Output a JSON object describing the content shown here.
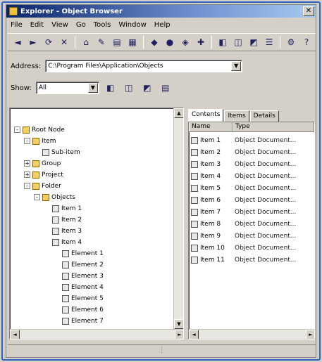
{
  "window": {
    "title": "Explorer - Object Browser"
  },
  "menu": [
    "File",
    "Edit",
    "View",
    "Go",
    "Tools",
    "Window",
    "Help"
  ],
  "toolbar": [
    "◄",
    "►",
    "⟳",
    "✕",
    "⌂",
    "✎",
    "▤",
    "▦",
    "◆",
    "●",
    "◈",
    "✚",
    "◧",
    "◫",
    "◩",
    "☰",
    "⚙",
    "?"
  ],
  "address": {
    "label": "Address:",
    "value": "C:\\Program Files\\Application\\Objects"
  },
  "filter": {
    "label": "Show:",
    "value": "All"
  },
  "tree": [
    {
      "indent": 0,
      "exp": "-",
      "label": "Root Node",
      "icon": "folder"
    },
    {
      "indent": 1,
      "exp": "-",
      "label": "Item",
      "icon": "folder"
    },
    {
      "indent": 2,
      "exp": "",
      "label": "Sub-item",
      "icon": "doc"
    },
    {
      "indent": 1,
      "exp": "+",
      "label": "Group",
      "icon": "folder"
    },
    {
      "indent": 1,
      "exp": "+",
      "label": "Project",
      "icon": "folder"
    },
    {
      "indent": 1,
      "exp": "-",
      "label": "Folder",
      "icon": "folder"
    },
    {
      "indent": 2,
      "exp": "-",
      "label": "Objects",
      "icon": "folder"
    },
    {
      "indent": 3,
      "exp": "",
      "label": "Item 1",
      "icon": "doc"
    },
    {
      "indent": 3,
      "exp": "",
      "label": "Item 2",
      "icon": "doc"
    },
    {
      "indent": 3,
      "exp": "",
      "label": "Item 3",
      "icon": "doc"
    },
    {
      "indent": 3,
      "exp": "",
      "label": "Item 4",
      "icon": "doc"
    },
    {
      "indent": 4,
      "exp": "",
      "label": "Element 1",
      "icon": "doc"
    },
    {
      "indent": 4,
      "exp": "",
      "label": "Element 2",
      "icon": "doc"
    },
    {
      "indent": 4,
      "exp": "",
      "label": "Element 3",
      "icon": "doc"
    },
    {
      "indent": 4,
      "exp": "",
      "label": "Element 4",
      "icon": "doc"
    },
    {
      "indent": 4,
      "exp": "",
      "label": "Element 5",
      "icon": "doc"
    },
    {
      "indent": 4,
      "exp": "",
      "label": "Element 6",
      "icon": "doc"
    },
    {
      "indent": 4,
      "exp": "",
      "label": "Element 7",
      "icon": "doc"
    }
  ],
  "tabs": [
    "Contents",
    "Items",
    "Details"
  ],
  "columns": [
    "Name",
    "Type"
  ],
  "rows": [
    {
      "name": "Item 1",
      "type": "Object Document..."
    },
    {
      "name": "Item 2",
      "type": "Object Document..."
    },
    {
      "name": "Item 3",
      "type": "Object Document..."
    },
    {
      "name": "Item 4",
      "type": "Object Document..."
    },
    {
      "name": "Item 5",
      "type": "Object Document..."
    },
    {
      "name": "Item 6",
      "type": "Object Document..."
    },
    {
      "name": "Item 7",
      "type": "Object Document..."
    },
    {
      "name": "Item 8",
      "type": "Object Document..."
    },
    {
      "name": "Item 9",
      "type": "Object Document..."
    },
    {
      "name": "Item 10",
      "type": "Object Document..."
    },
    {
      "name": "Item 11",
      "type": "Object Document..."
    }
  ]
}
